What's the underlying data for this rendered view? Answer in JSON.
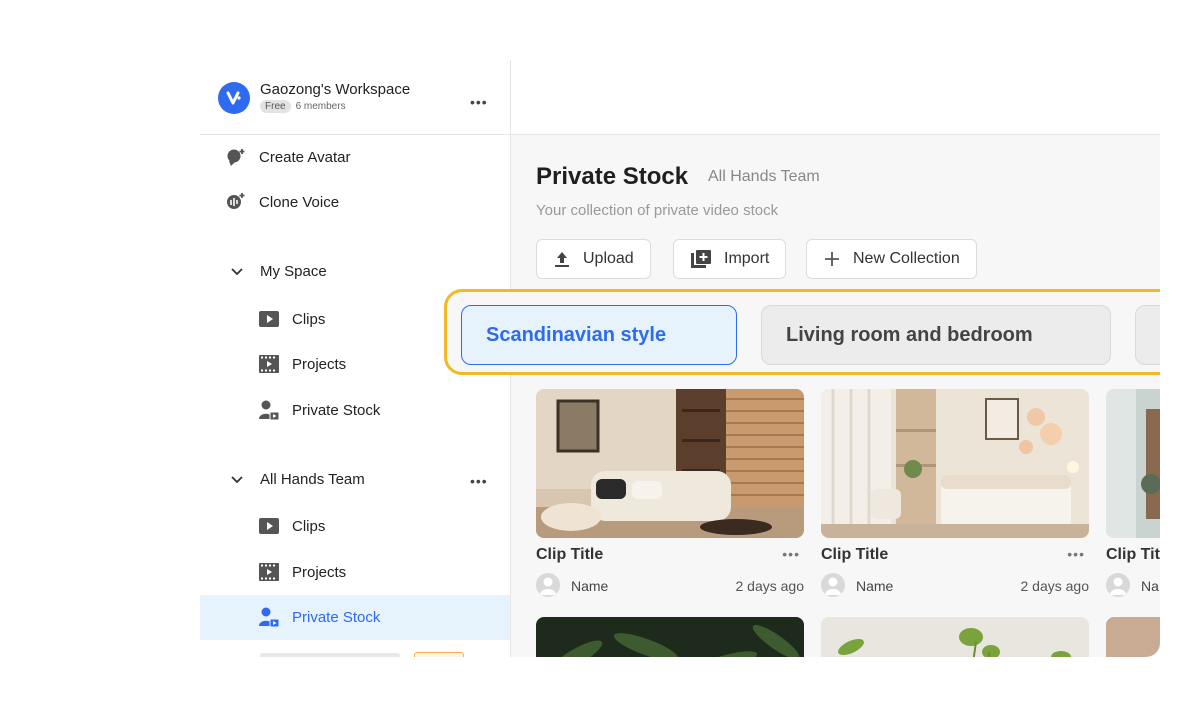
{
  "workspace": {
    "name": "Gaozong's Workspace",
    "plan": "Free",
    "members": "6 members",
    "more": "•••"
  },
  "nav": {
    "create_avatar": "Create Avatar",
    "clone_voice": "Clone Voice",
    "my_space": {
      "label": "My Space",
      "items": [
        "Clips",
        "Projects",
        "Private Stock"
      ]
    },
    "team": {
      "label": "All Hands Team",
      "more": "•••",
      "items": [
        "Clips",
        "Projects",
        "Private Stock"
      ]
    }
  },
  "main": {
    "title": "Private Stock",
    "team": "All Hands Team",
    "description": "Your collection of private video stock",
    "buttons": {
      "upload": "Upload",
      "import": "Import",
      "new_collection": "New Collection"
    },
    "collections": [
      "Scandinavian style",
      "Living room and bedroom"
    ],
    "clips": [
      {
        "title": "Clip Title",
        "owner": "Name",
        "time": "2 days ago",
        "more": "•••"
      },
      {
        "title": "Clip Title",
        "owner": "Name",
        "time": "2 days ago",
        "more": "•••"
      },
      {
        "title": "Clip Tit",
        "owner": "Na",
        "time": "",
        "more": ""
      }
    ]
  },
  "colors": {
    "accent": "#2f6bf0",
    "highlight_border": "#f3b825",
    "active_bg": "#e6f3fd"
  },
  "icons": [
    "workspace-logo-icon",
    "avatar-icon",
    "voice-icon",
    "chevron-down-icon",
    "play-icon",
    "film-icon",
    "user-stock-icon",
    "upload-icon",
    "import-icon",
    "plus-icon",
    "more-icon"
  ]
}
